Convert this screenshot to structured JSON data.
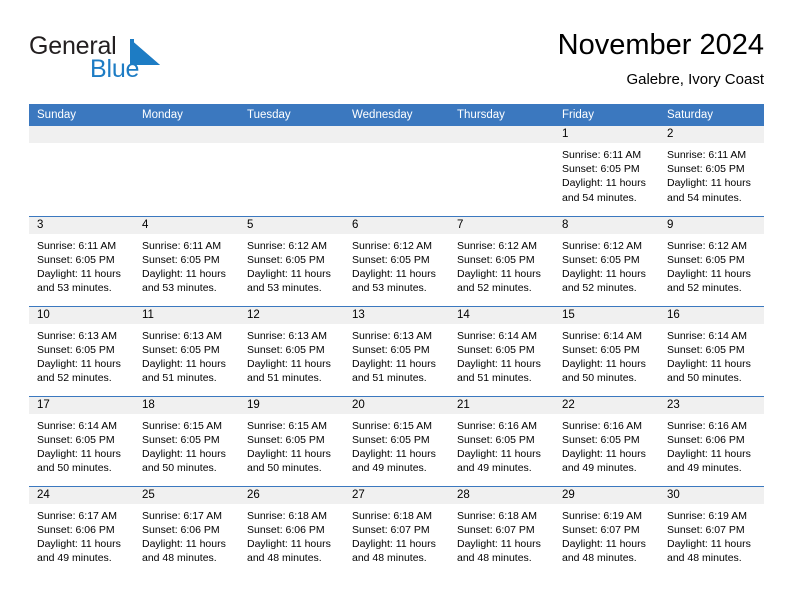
{
  "brand": {
    "name_part1": "General",
    "name_part2": "Blue",
    "logo_icon": "triangle-logo-icon",
    "accent_color": "#1d7cc4"
  },
  "header": {
    "title": "November 2024",
    "subtitle": "Galebre, Ivory Coast"
  },
  "colors": {
    "header_row_background": "#3b78bf",
    "day_number_band": "#f0f0f0",
    "row_separator": "#3b78bf",
    "text": "#000000"
  },
  "weekday_headers": [
    "Sunday",
    "Monday",
    "Tuesday",
    "Wednesday",
    "Thursday",
    "Friday",
    "Saturday"
  ],
  "weeks": [
    [
      {
        "day": "",
        "empty": true,
        "sunrise": "",
        "sunset": "",
        "daylight_line1": "",
        "daylight_line2": ""
      },
      {
        "day": "",
        "empty": true,
        "sunrise": "",
        "sunset": "",
        "daylight_line1": "",
        "daylight_line2": ""
      },
      {
        "day": "",
        "empty": true,
        "sunrise": "",
        "sunset": "",
        "daylight_line1": "",
        "daylight_line2": ""
      },
      {
        "day": "",
        "empty": true,
        "sunrise": "",
        "sunset": "",
        "daylight_line1": "",
        "daylight_line2": ""
      },
      {
        "day": "",
        "empty": true,
        "sunrise": "",
        "sunset": "",
        "daylight_line1": "",
        "daylight_line2": ""
      },
      {
        "day": "1",
        "empty": false,
        "sunrise": "Sunrise: 6:11 AM",
        "sunset": "Sunset: 6:05 PM",
        "daylight_line1": "Daylight: 11 hours",
        "daylight_line2": "and 54 minutes."
      },
      {
        "day": "2",
        "empty": false,
        "sunrise": "Sunrise: 6:11 AM",
        "sunset": "Sunset: 6:05 PM",
        "daylight_line1": "Daylight: 11 hours",
        "daylight_line2": "and 54 minutes."
      }
    ],
    [
      {
        "day": "3",
        "empty": false,
        "sunrise": "Sunrise: 6:11 AM",
        "sunset": "Sunset: 6:05 PM",
        "daylight_line1": "Daylight: 11 hours",
        "daylight_line2": "and 53 minutes."
      },
      {
        "day": "4",
        "empty": false,
        "sunrise": "Sunrise: 6:11 AM",
        "sunset": "Sunset: 6:05 PM",
        "daylight_line1": "Daylight: 11 hours",
        "daylight_line2": "and 53 minutes."
      },
      {
        "day": "5",
        "empty": false,
        "sunrise": "Sunrise: 6:12 AM",
        "sunset": "Sunset: 6:05 PM",
        "daylight_line1": "Daylight: 11 hours",
        "daylight_line2": "and 53 minutes."
      },
      {
        "day": "6",
        "empty": false,
        "sunrise": "Sunrise: 6:12 AM",
        "sunset": "Sunset: 6:05 PM",
        "daylight_line1": "Daylight: 11 hours",
        "daylight_line2": "and 53 minutes."
      },
      {
        "day": "7",
        "empty": false,
        "sunrise": "Sunrise: 6:12 AM",
        "sunset": "Sunset: 6:05 PM",
        "daylight_line1": "Daylight: 11 hours",
        "daylight_line2": "and 52 minutes."
      },
      {
        "day": "8",
        "empty": false,
        "sunrise": "Sunrise: 6:12 AM",
        "sunset": "Sunset: 6:05 PM",
        "daylight_line1": "Daylight: 11 hours",
        "daylight_line2": "and 52 minutes."
      },
      {
        "day": "9",
        "empty": false,
        "sunrise": "Sunrise: 6:12 AM",
        "sunset": "Sunset: 6:05 PM",
        "daylight_line1": "Daylight: 11 hours",
        "daylight_line2": "and 52 minutes."
      }
    ],
    [
      {
        "day": "10",
        "empty": false,
        "sunrise": "Sunrise: 6:13 AM",
        "sunset": "Sunset: 6:05 PM",
        "daylight_line1": "Daylight: 11 hours",
        "daylight_line2": "and 52 minutes."
      },
      {
        "day": "11",
        "empty": false,
        "sunrise": "Sunrise: 6:13 AM",
        "sunset": "Sunset: 6:05 PM",
        "daylight_line1": "Daylight: 11 hours",
        "daylight_line2": "and 51 minutes."
      },
      {
        "day": "12",
        "empty": false,
        "sunrise": "Sunrise: 6:13 AM",
        "sunset": "Sunset: 6:05 PM",
        "daylight_line1": "Daylight: 11 hours",
        "daylight_line2": "and 51 minutes."
      },
      {
        "day": "13",
        "empty": false,
        "sunrise": "Sunrise: 6:13 AM",
        "sunset": "Sunset: 6:05 PM",
        "daylight_line1": "Daylight: 11 hours",
        "daylight_line2": "and 51 minutes."
      },
      {
        "day": "14",
        "empty": false,
        "sunrise": "Sunrise: 6:14 AM",
        "sunset": "Sunset: 6:05 PM",
        "daylight_line1": "Daylight: 11 hours",
        "daylight_line2": "and 51 minutes."
      },
      {
        "day": "15",
        "empty": false,
        "sunrise": "Sunrise: 6:14 AM",
        "sunset": "Sunset: 6:05 PM",
        "daylight_line1": "Daylight: 11 hours",
        "daylight_line2": "and 50 minutes."
      },
      {
        "day": "16",
        "empty": false,
        "sunrise": "Sunrise: 6:14 AM",
        "sunset": "Sunset: 6:05 PM",
        "daylight_line1": "Daylight: 11 hours",
        "daylight_line2": "and 50 minutes."
      }
    ],
    [
      {
        "day": "17",
        "empty": false,
        "sunrise": "Sunrise: 6:14 AM",
        "sunset": "Sunset: 6:05 PM",
        "daylight_line1": "Daylight: 11 hours",
        "daylight_line2": "and 50 minutes."
      },
      {
        "day": "18",
        "empty": false,
        "sunrise": "Sunrise: 6:15 AM",
        "sunset": "Sunset: 6:05 PM",
        "daylight_line1": "Daylight: 11 hours",
        "daylight_line2": "and 50 minutes."
      },
      {
        "day": "19",
        "empty": false,
        "sunrise": "Sunrise: 6:15 AM",
        "sunset": "Sunset: 6:05 PM",
        "daylight_line1": "Daylight: 11 hours",
        "daylight_line2": "and 50 minutes."
      },
      {
        "day": "20",
        "empty": false,
        "sunrise": "Sunrise: 6:15 AM",
        "sunset": "Sunset: 6:05 PM",
        "daylight_line1": "Daylight: 11 hours",
        "daylight_line2": "and 49 minutes."
      },
      {
        "day": "21",
        "empty": false,
        "sunrise": "Sunrise: 6:16 AM",
        "sunset": "Sunset: 6:05 PM",
        "daylight_line1": "Daylight: 11 hours",
        "daylight_line2": "and 49 minutes."
      },
      {
        "day": "22",
        "empty": false,
        "sunrise": "Sunrise: 6:16 AM",
        "sunset": "Sunset: 6:05 PM",
        "daylight_line1": "Daylight: 11 hours",
        "daylight_line2": "and 49 minutes."
      },
      {
        "day": "23",
        "empty": false,
        "sunrise": "Sunrise: 6:16 AM",
        "sunset": "Sunset: 6:06 PM",
        "daylight_line1": "Daylight: 11 hours",
        "daylight_line2": "and 49 minutes."
      }
    ],
    [
      {
        "day": "24",
        "empty": false,
        "sunrise": "Sunrise: 6:17 AM",
        "sunset": "Sunset: 6:06 PM",
        "daylight_line1": "Daylight: 11 hours",
        "daylight_line2": "and 49 minutes."
      },
      {
        "day": "25",
        "empty": false,
        "sunrise": "Sunrise: 6:17 AM",
        "sunset": "Sunset: 6:06 PM",
        "daylight_line1": "Daylight: 11 hours",
        "daylight_line2": "and 48 minutes."
      },
      {
        "day": "26",
        "empty": false,
        "sunrise": "Sunrise: 6:18 AM",
        "sunset": "Sunset: 6:06 PM",
        "daylight_line1": "Daylight: 11 hours",
        "daylight_line2": "and 48 minutes."
      },
      {
        "day": "27",
        "empty": false,
        "sunrise": "Sunrise: 6:18 AM",
        "sunset": "Sunset: 6:07 PM",
        "daylight_line1": "Daylight: 11 hours",
        "daylight_line2": "and 48 minutes."
      },
      {
        "day": "28",
        "empty": false,
        "sunrise": "Sunrise: 6:18 AM",
        "sunset": "Sunset: 6:07 PM",
        "daylight_line1": "Daylight: 11 hours",
        "daylight_line2": "and 48 minutes."
      },
      {
        "day": "29",
        "empty": false,
        "sunrise": "Sunrise: 6:19 AM",
        "sunset": "Sunset: 6:07 PM",
        "daylight_line1": "Daylight: 11 hours",
        "daylight_line2": "and 48 minutes."
      },
      {
        "day": "30",
        "empty": false,
        "sunrise": "Sunrise: 6:19 AM",
        "sunset": "Sunset: 6:07 PM",
        "daylight_line1": "Daylight: 11 hours",
        "daylight_line2": "and 48 minutes."
      }
    ]
  ]
}
